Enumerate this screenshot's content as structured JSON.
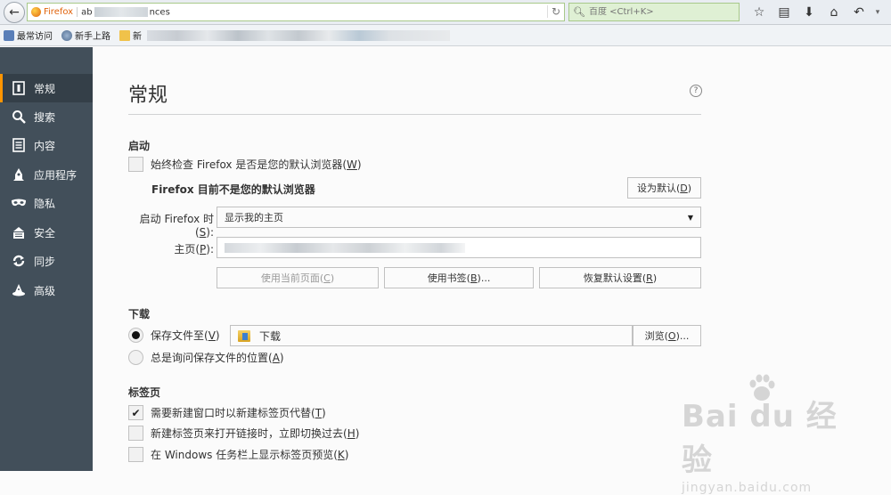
{
  "toolbar": {
    "firefox_label": "Firefox",
    "url_prefix": "ab",
    "url_suffix": "nces",
    "search_placeholder": "百度 <Ctrl+K>"
  },
  "bookmarks": {
    "items": [
      {
        "label": "最常访问",
        "icon": "page-icon"
      },
      {
        "label": "新手上路",
        "icon": "globe-icon"
      },
      {
        "label": "新",
        "icon": "folder-icon"
      }
    ]
  },
  "sidebar": {
    "items": [
      {
        "label": "常规",
        "icon": "general-icon",
        "active": true
      },
      {
        "label": "搜索",
        "icon": "search-icon"
      },
      {
        "label": "内容",
        "icon": "content-icon"
      },
      {
        "label": "应用程序",
        "icon": "applications-icon"
      },
      {
        "label": "隐私",
        "icon": "privacy-mask-icon"
      },
      {
        "label": "安全",
        "icon": "security-lock-icon"
      },
      {
        "label": "同步",
        "icon": "sync-icon"
      },
      {
        "label": "高级",
        "icon": "advanced-wizard-icon"
      }
    ]
  },
  "main": {
    "title": "常规",
    "help": "?",
    "startup": {
      "heading": "启动",
      "always_check_pre": "始终检查 Firefox 是否是您的默认浏览器(",
      "always_check_key": "W",
      "always_check_post": ")",
      "not_default_msg": "Firefox 目前不是您的默认浏览器",
      "set_default_pre": "设为默认(",
      "set_default_key": "D",
      "set_default_post": ")",
      "when_starts_pre": "启动 Firefox 时(",
      "when_starts_key": "S",
      "when_starts_post": "):",
      "when_starts_value": "显示我的主页",
      "homepage_pre": "主页(",
      "homepage_key": "P",
      "homepage_post": "):",
      "use_current_pre": "使用当前页面(",
      "use_current_key": "C",
      "use_current_post": ")",
      "use_bookmark_pre": "使用书签(",
      "use_bookmark_key": "B",
      "use_bookmark_post": ")...",
      "restore_default_pre": "恢复默认设置(",
      "restore_default_key": "R",
      "restore_default_post": ")"
    },
    "downloads": {
      "heading": "下载",
      "save_to_pre": "保存文件至(",
      "save_to_key": "V",
      "save_to_post": ")",
      "save_to_folder": "下载",
      "browse_pre": "浏览(",
      "browse_key": "O",
      "browse_post": ")...",
      "always_ask_pre": "总是询问保存文件的位置(",
      "always_ask_key": "A",
      "always_ask_post": ")"
    },
    "tabs": {
      "heading": "标签页",
      "open_new_windows_pre": "需要新建窗口时以新建标签页代替(",
      "open_new_windows_key": "T",
      "open_new_windows_post": ")",
      "switch_to_tab_pre": "新建标签页来打开链接时，立即切换过去(",
      "switch_to_tab_key": "H",
      "switch_to_tab_post": ")",
      "taskbar_previews_pre": "在 Windows 任务栏上显示标签页预览(",
      "taskbar_previews_key": "K",
      "taskbar_previews_post": ")"
    }
  },
  "watermark": {
    "brand": "Bai du 经验",
    "url": "jingyan.baidu.com"
  }
}
